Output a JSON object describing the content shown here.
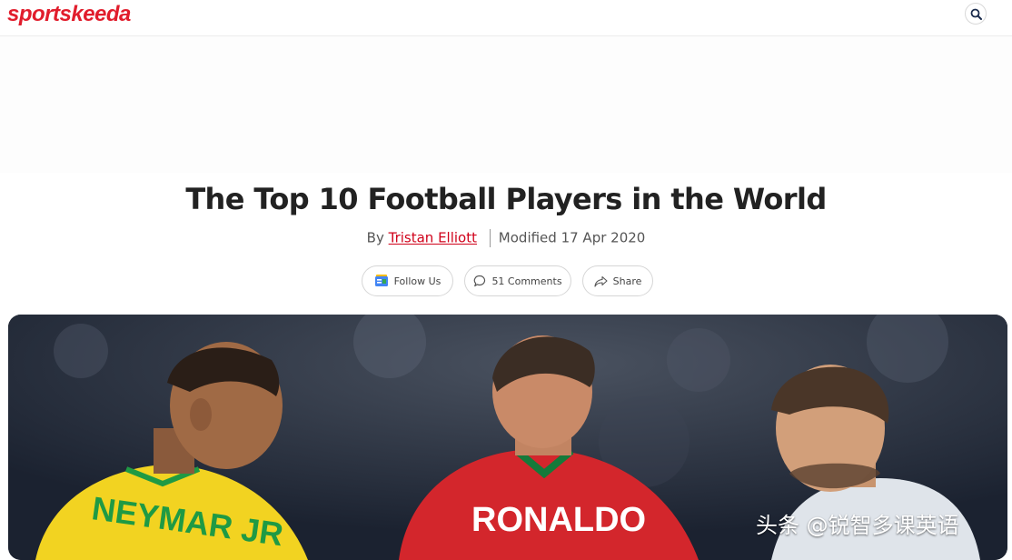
{
  "header": {
    "logo_text": "sportskeeda",
    "search_icon": "search-icon"
  },
  "article": {
    "title": "The Top 10 Football Players in the World",
    "by_label": "By",
    "author": "Tristan Elliott",
    "modified": "Modified 17 Apr 2020"
  },
  "actions": {
    "follow_label": "Follow Us",
    "comments_label": "51 Comments",
    "share_label": "Share"
  },
  "hero": {
    "jersey_left": "NEYMAR JR",
    "jersey_center": "RONALDO"
  },
  "watermark": "头条 @锐智多课英语",
  "colors": {
    "brand": "#e11d2c",
    "author_link": "#d0021b",
    "brazil_yellow": "#f2d321",
    "portugal_red": "#d3262c"
  }
}
